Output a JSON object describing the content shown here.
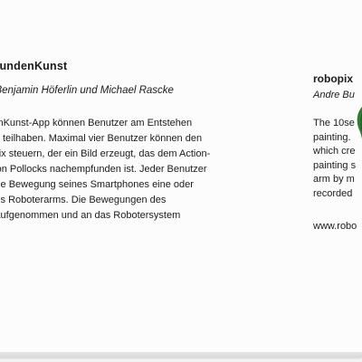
{
  "left": {
    "title": "sekundenKunst",
    "authors": "ski, Benjamin Höferlin und Michael Rascke",
    "body_lines": [
      "undenKunst-App können Benutzer am Entstehen",
      "erkes teilhaben. Maximal vier Benutzer können den",
      "oboPix steuern, der ein Bild erzeugt, das dem Action-",
      "ackson Pollocks nachempfunden ist. Jeder Benutzer",
      "ber die Bewegung seines Smartphones eine oder",
      "en des Roboterarms. Die Bewegungen des",
      "den aufgenommen und an das Robotersystem"
    ],
    "partial": "e"
  },
  "right": {
    "title": "robopix",
    "authors": "Andre Bu",
    "body_lines": [
      "The 10se",
      "painting.",
      "which cre",
      "painting s",
      "arm by m",
      "recorded"
    ],
    "url": "www.robo"
  }
}
